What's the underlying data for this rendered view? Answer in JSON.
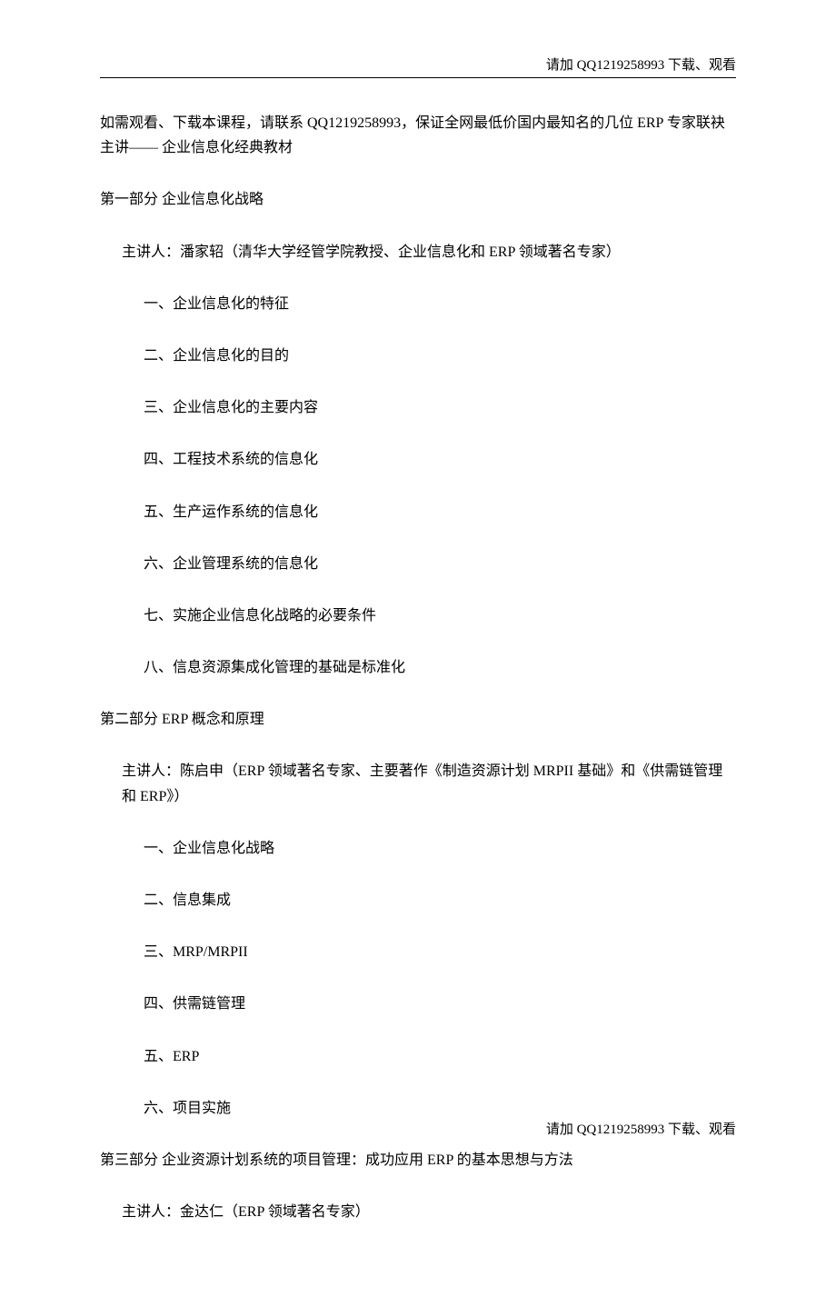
{
  "header_text": "请加 QQ1219258993 下载、观看",
  "footer_text": "请加 QQ1219258993 下载、观看",
  "intro": "如需观看、下载本课程，请联系 QQ1219258993，保证全网最低价国内最知名的几位 ERP 专家联袂主讲——  企业信息化经典教材",
  "sections": [
    {
      "title": "第一部分   企业信息化战略",
      "lecturer": "主讲人：潘家轺（清华大学经管学院教授、企业信息化和 ERP 领域著名专家）",
      "topics": [
        "一、企业信息化的特征",
        "二、企业信息化的目的",
        "三、企业信息化的主要内容",
        "四、工程技术系统的信息化",
        "五、生产运作系统的信息化",
        "六、企业管理系统的信息化",
        "七、实施企业信息化战略的必要条件",
        "八、信息资源集成化管理的基础是标准化"
      ]
    },
    {
      "title": "第二部分   ERP 概念和原理",
      "lecturer": "主讲人：陈启申（ERP 领域著名专家、主要著作《制造资源计划 MRPII 基础》和《供需链管理和 ERP》）",
      "topics": [
        "一、企业信息化战略",
        "二、信息集成",
        "三、MRP/MRPII",
        "四、供需链管理",
        "五、ERP",
        "六、项目实施"
      ]
    },
    {
      "title": "第三部分  企业资源计划系统的项目管理：成功应用 ERP 的基本思想与方法",
      "lecturer": "主讲人：金达仁（ERP 领域著名专家）",
      "topics": []
    }
  ]
}
